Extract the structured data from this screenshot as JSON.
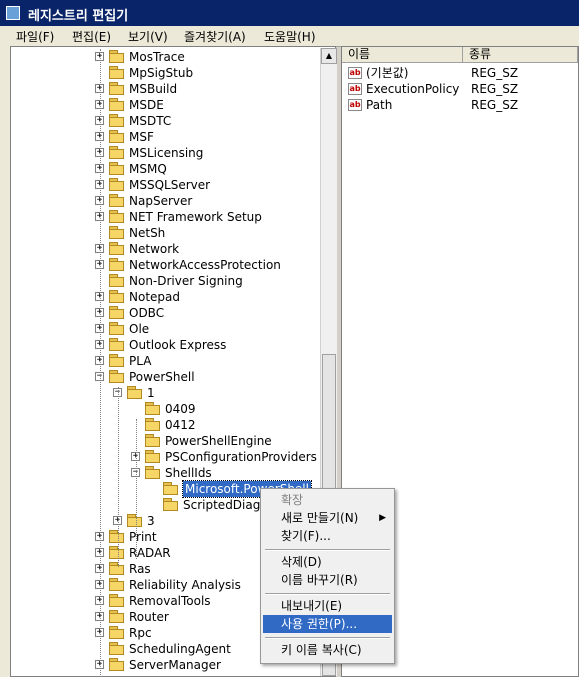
{
  "window": {
    "title": "레지스트리 편집기"
  },
  "menu": [
    "파일(F)",
    "편집(E)",
    "보기(V)",
    "즐겨찾기(A)",
    "도움말(H)"
  ],
  "tree": [
    {
      "label": "MosTrace",
      "pm": "+",
      "lvl": 0
    },
    {
      "label": "MpSigStub",
      "pm": "",
      "lvl": 0
    },
    {
      "label": "MSBuild",
      "pm": "+",
      "lvl": 0
    },
    {
      "label": "MSDE",
      "pm": "+",
      "lvl": 0
    },
    {
      "label": "MSDTC",
      "pm": "+",
      "lvl": 0
    },
    {
      "label": "MSF",
      "pm": "+",
      "lvl": 0
    },
    {
      "label": "MSLicensing",
      "pm": "+",
      "lvl": 0
    },
    {
      "label": "MSMQ",
      "pm": "+",
      "lvl": 0
    },
    {
      "label": "MSSQLServer",
      "pm": "+",
      "lvl": 0
    },
    {
      "label": "NapServer",
      "pm": "+",
      "lvl": 0
    },
    {
      "label": "NET Framework Setup",
      "pm": "+",
      "lvl": 0
    },
    {
      "label": "NetSh",
      "pm": "",
      "lvl": 0
    },
    {
      "label": "Network",
      "pm": "+",
      "lvl": 0
    },
    {
      "label": "NetworkAccessProtection",
      "pm": "+",
      "lvl": 0
    },
    {
      "label": "Non-Driver Signing",
      "pm": "",
      "lvl": 0
    },
    {
      "label": "Notepad",
      "pm": "+",
      "lvl": 0
    },
    {
      "label": "ODBC",
      "pm": "+",
      "lvl": 0
    },
    {
      "label": "Ole",
      "pm": "+",
      "lvl": 0
    },
    {
      "label": "Outlook Express",
      "pm": "+",
      "lvl": 0
    },
    {
      "label": "PLA",
      "pm": "+",
      "lvl": 0
    },
    {
      "label": "PowerShell",
      "pm": "-",
      "lvl": 0
    },
    {
      "label": "1",
      "pm": "-",
      "lvl": 1
    },
    {
      "label": "0409",
      "pm": "",
      "lvl": 2
    },
    {
      "label": "0412",
      "pm": "",
      "lvl": 2
    },
    {
      "label": "PowerShellEngine",
      "pm": "",
      "lvl": 2
    },
    {
      "label": "PSConfigurationProviders",
      "pm": "+",
      "lvl": 2
    },
    {
      "label": "ShellIds",
      "pm": "-",
      "lvl": 2
    },
    {
      "label": "Microsoft.PowerShell",
      "pm": "",
      "lvl": 3,
      "sel": true
    },
    {
      "label": "ScriptedDiag",
      "pm": "",
      "lvl": 3
    },
    {
      "label": "3",
      "pm": "+",
      "lvl": 1
    },
    {
      "label": "Print",
      "pm": "+",
      "lvl": 0
    },
    {
      "label": "RADAR",
      "pm": "+",
      "lvl": 0
    },
    {
      "label": "Ras",
      "pm": "+",
      "lvl": 0
    },
    {
      "label": "Reliability Analysis",
      "pm": "+",
      "lvl": 0
    },
    {
      "label": "RemovalTools",
      "pm": "+",
      "lvl": 0
    },
    {
      "label": "Router",
      "pm": "+",
      "lvl": 0
    },
    {
      "label": "Rpc",
      "pm": "+",
      "lvl": 0
    },
    {
      "label": "SchedulingAgent",
      "pm": "",
      "lvl": 0
    },
    {
      "label": "ServerManager",
      "pm": "+",
      "lvl": 0
    }
  ],
  "columns": {
    "name": "이름",
    "type": "종류"
  },
  "values": [
    {
      "name": "(기본값)",
      "type": "REG_SZ"
    },
    {
      "name": "ExecutionPolicy",
      "type": "REG_SZ"
    },
    {
      "name": "Path",
      "type": "REG_SZ"
    }
  ],
  "context_menu": {
    "expand": "확장",
    "new": "새로 만들기(N)",
    "find": "찾기(F)...",
    "delete": "삭제(D)",
    "rename": "이름 바꾸기(R)",
    "export": "내보내기(E)",
    "permissions": "사용 권한(P)...",
    "copy_key_name": "키 이름 복사(C)"
  },
  "colors": {
    "titlebar": "#0a246a",
    "selection": "#316ac5",
    "folder": "#f5d667"
  },
  "icons": {
    "string_value": "ab"
  }
}
